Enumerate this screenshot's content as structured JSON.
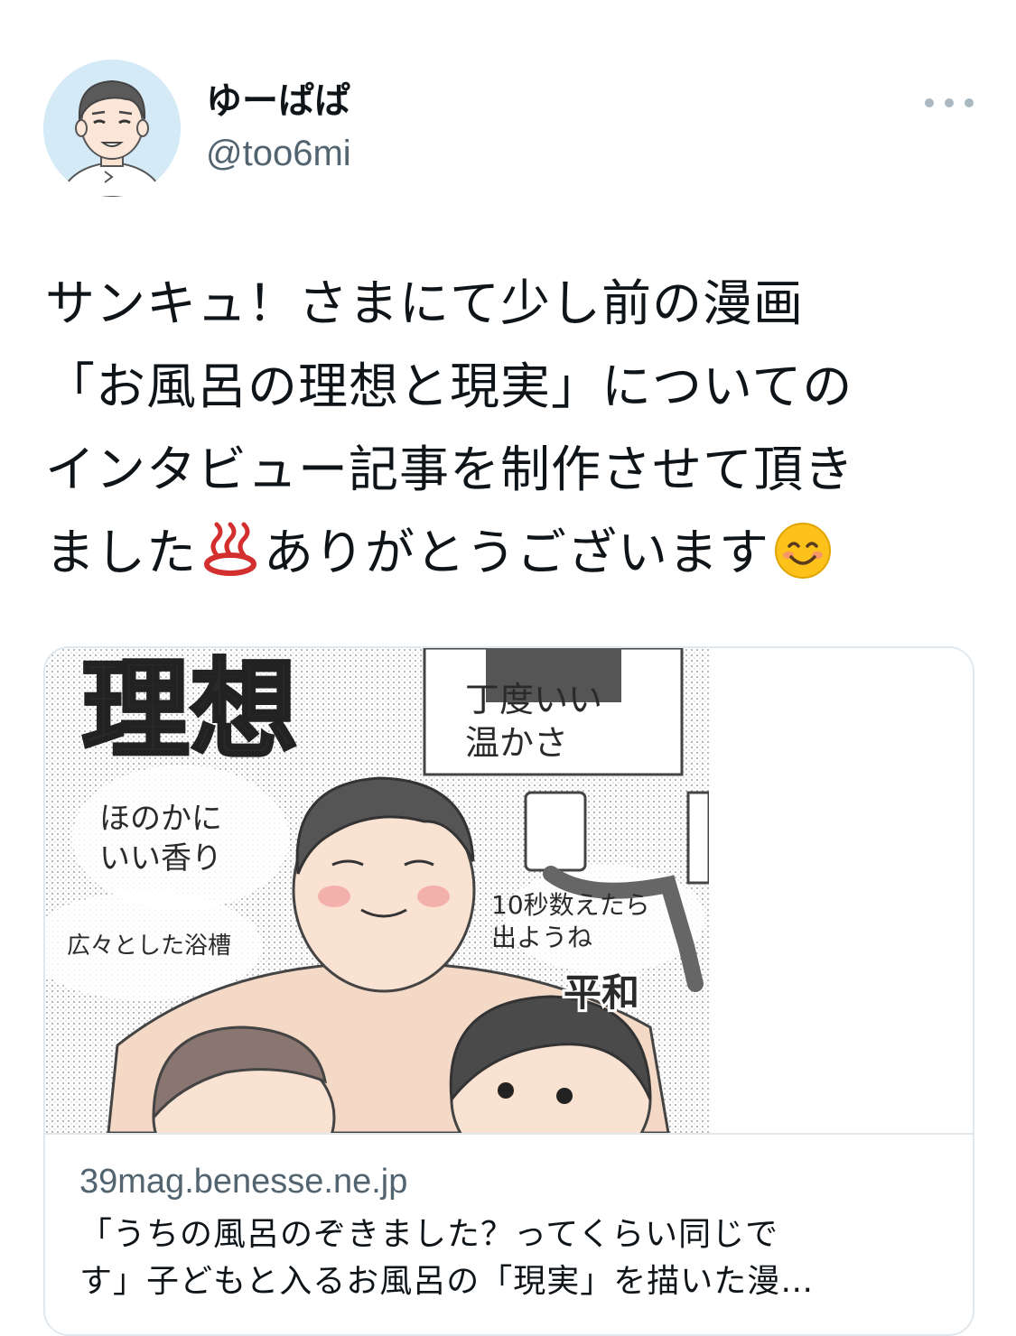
{
  "tweet": {
    "author": {
      "display_name": "ゆーぱぱ",
      "handle": "@too6mi",
      "avatar_icon": "user-avatar-illustration"
    },
    "more_icon": "more-horizontal-icon",
    "text_lines": [
      "サンキュ！さまにて少し前の漫画",
      "「お風呂の理想と現実」についての",
      "インタビュー記事を制作させて頂き",
      "ました"
    ],
    "text_line4_after_emoji": "ありがとうございます",
    "emojis": [
      "hot-springs-emoji",
      "smiling-face-emoji"
    ]
  },
  "card": {
    "image": {
      "title_text": "理想",
      "labels": {
        "temp": [
          "丁度いい",
          "温かさ"
        ],
        "scent": [
          "ほのかに",
          "いい香り"
        ],
        "tub": "広々とした浴槽",
        "count": [
          "10秒数えたら",
          "出ようね"
        ],
        "peace": "平和"
      }
    },
    "domain": "39mag.benesse.ne.jp",
    "title_lines": [
      "「うちの風呂のぞきました？ってくらい同じで",
      "す」子どもと入るお風呂の「現実」を描いた漫…"
    ]
  },
  "colors": {
    "text_primary": "#0f1419",
    "text_secondary": "#536471",
    "border": "#e1e8ed",
    "more_dots": "#aab8c2"
  }
}
